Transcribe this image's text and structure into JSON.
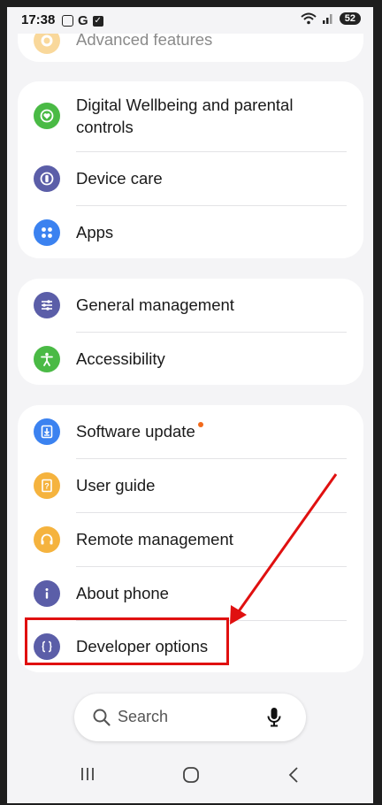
{
  "status_bar": {
    "time": "17:38",
    "g_label": "G",
    "battery": "52"
  },
  "settings": {
    "advanced": {
      "label": "Advanced features",
      "icon": "gear-icon",
      "color": "#f5b94a"
    },
    "group1": [
      {
        "label_line1": "Digital Wellbeing and parental",
        "label_line2": "controls",
        "icon": "heart-icon",
        "color": "#4aba45"
      },
      {
        "label": "Device care",
        "icon": "device-care-icon",
        "color": "#5b5ea8"
      },
      {
        "label": "Apps",
        "icon": "apps-grid-icon",
        "color": "#3b82f0"
      }
    ],
    "group2": [
      {
        "label": "General management",
        "icon": "sliders-icon",
        "color": "#5b5ea8"
      },
      {
        "label": "Accessibility",
        "icon": "accessibility-icon",
        "color": "#4aba45"
      }
    ],
    "group3": [
      {
        "label": "Software update",
        "icon": "download-icon",
        "color": "#3b82f0",
        "badge": true
      },
      {
        "label": "User guide",
        "icon": "guide-icon",
        "color": "#f5b33e"
      },
      {
        "label": "Remote management",
        "icon": "headset-icon",
        "color": "#f5b33e"
      },
      {
        "label": "About phone",
        "icon": "info-icon",
        "color": "#5b5ea8"
      },
      {
        "label": "Developer options",
        "icon": "braces-icon",
        "color": "#5b5ea8"
      }
    ]
  },
  "search": {
    "placeholder": "Search"
  },
  "annotation": {
    "color": "#e01010"
  }
}
